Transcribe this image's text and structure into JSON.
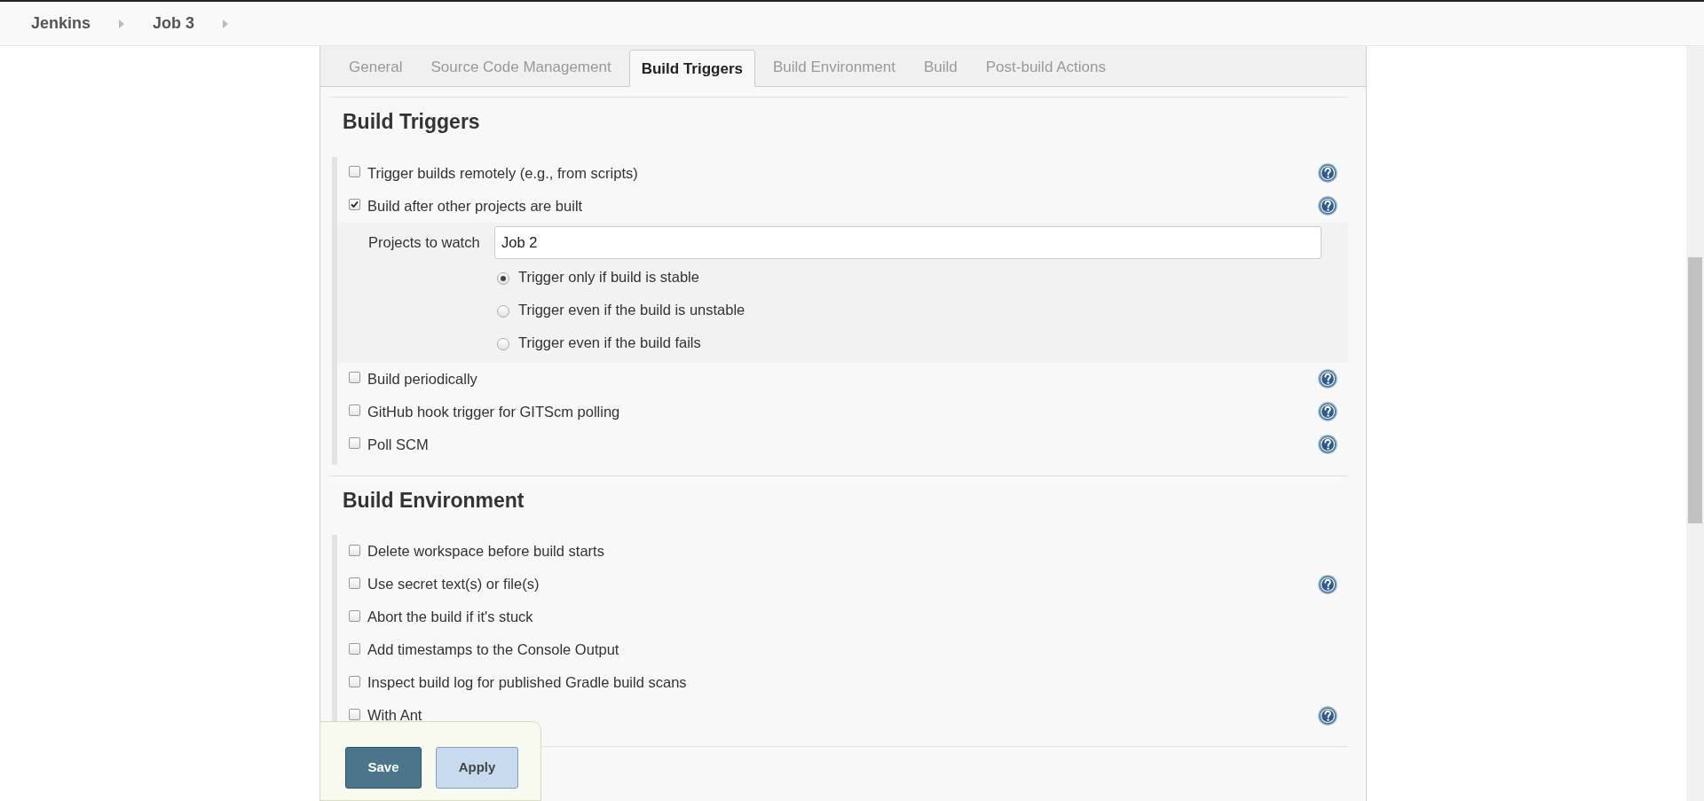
{
  "breadcrumbs": [
    {
      "label": "Jenkins"
    },
    {
      "label": "Job 3"
    }
  ],
  "tabs": [
    {
      "label": "General",
      "selected": false
    },
    {
      "label": "Source Code Management",
      "selected": false
    },
    {
      "label": "Build Triggers",
      "selected": true
    },
    {
      "label": "Build Environment",
      "selected": false
    },
    {
      "label": "Build",
      "selected": false
    },
    {
      "label": "Post-build Actions",
      "selected": false
    }
  ],
  "sections": [
    {
      "title": "Build Triggers",
      "options": [
        {
          "label": "Trigger builds remotely (e.g., from scripts)",
          "checked": false,
          "help": true
        },
        {
          "label": "Build after other projects are built",
          "checked": true,
          "help": true,
          "details": {
            "field_label": "Projects to watch",
            "field_value": "Job 2",
            "radios": [
              {
                "label": "Trigger only if build is stable",
                "selected": true
              },
              {
                "label": "Trigger even if the build is unstable",
                "selected": false
              },
              {
                "label": "Trigger even if the build fails",
                "selected": false
              }
            ]
          }
        },
        {
          "label": "Build periodically",
          "checked": false,
          "help": true
        },
        {
          "label": "GitHub hook trigger for GITScm polling",
          "checked": false,
          "help": true
        },
        {
          "label": "Poll SCM",
          "checked": false,
          "help": true
        }
      ]
    },
    {
      "title": "Build Environment",
      "options": [
        {
          "label": "Delete workspace before build starts",
          "checked": false,
          "help": false
        },
        {
          "label": "Use secret text(s) or file(s)",
          "checked": false,
          "help": true
        },
        {
          "label": "Abort the build if it's stuck",
          "checked": false,
          "help": false
        },
        {
          "label": "Add timestamps to the Console Output",
          "checked": false,
          "help": false
        },
        {
          "label": "Inspect build log for published Gradle build scans",
          "checked": false,
          "help": false
        },
        {
          "label": "With Ant",
          "checked": false,
          "help": true
        }
      ]
    }
  ],
  "buttons": [
    {
      "label": "Save",
      "kind": "primary"
    },
    {
      "label": "Apply",
      "kind": "secondary"
    }
  ]
}
